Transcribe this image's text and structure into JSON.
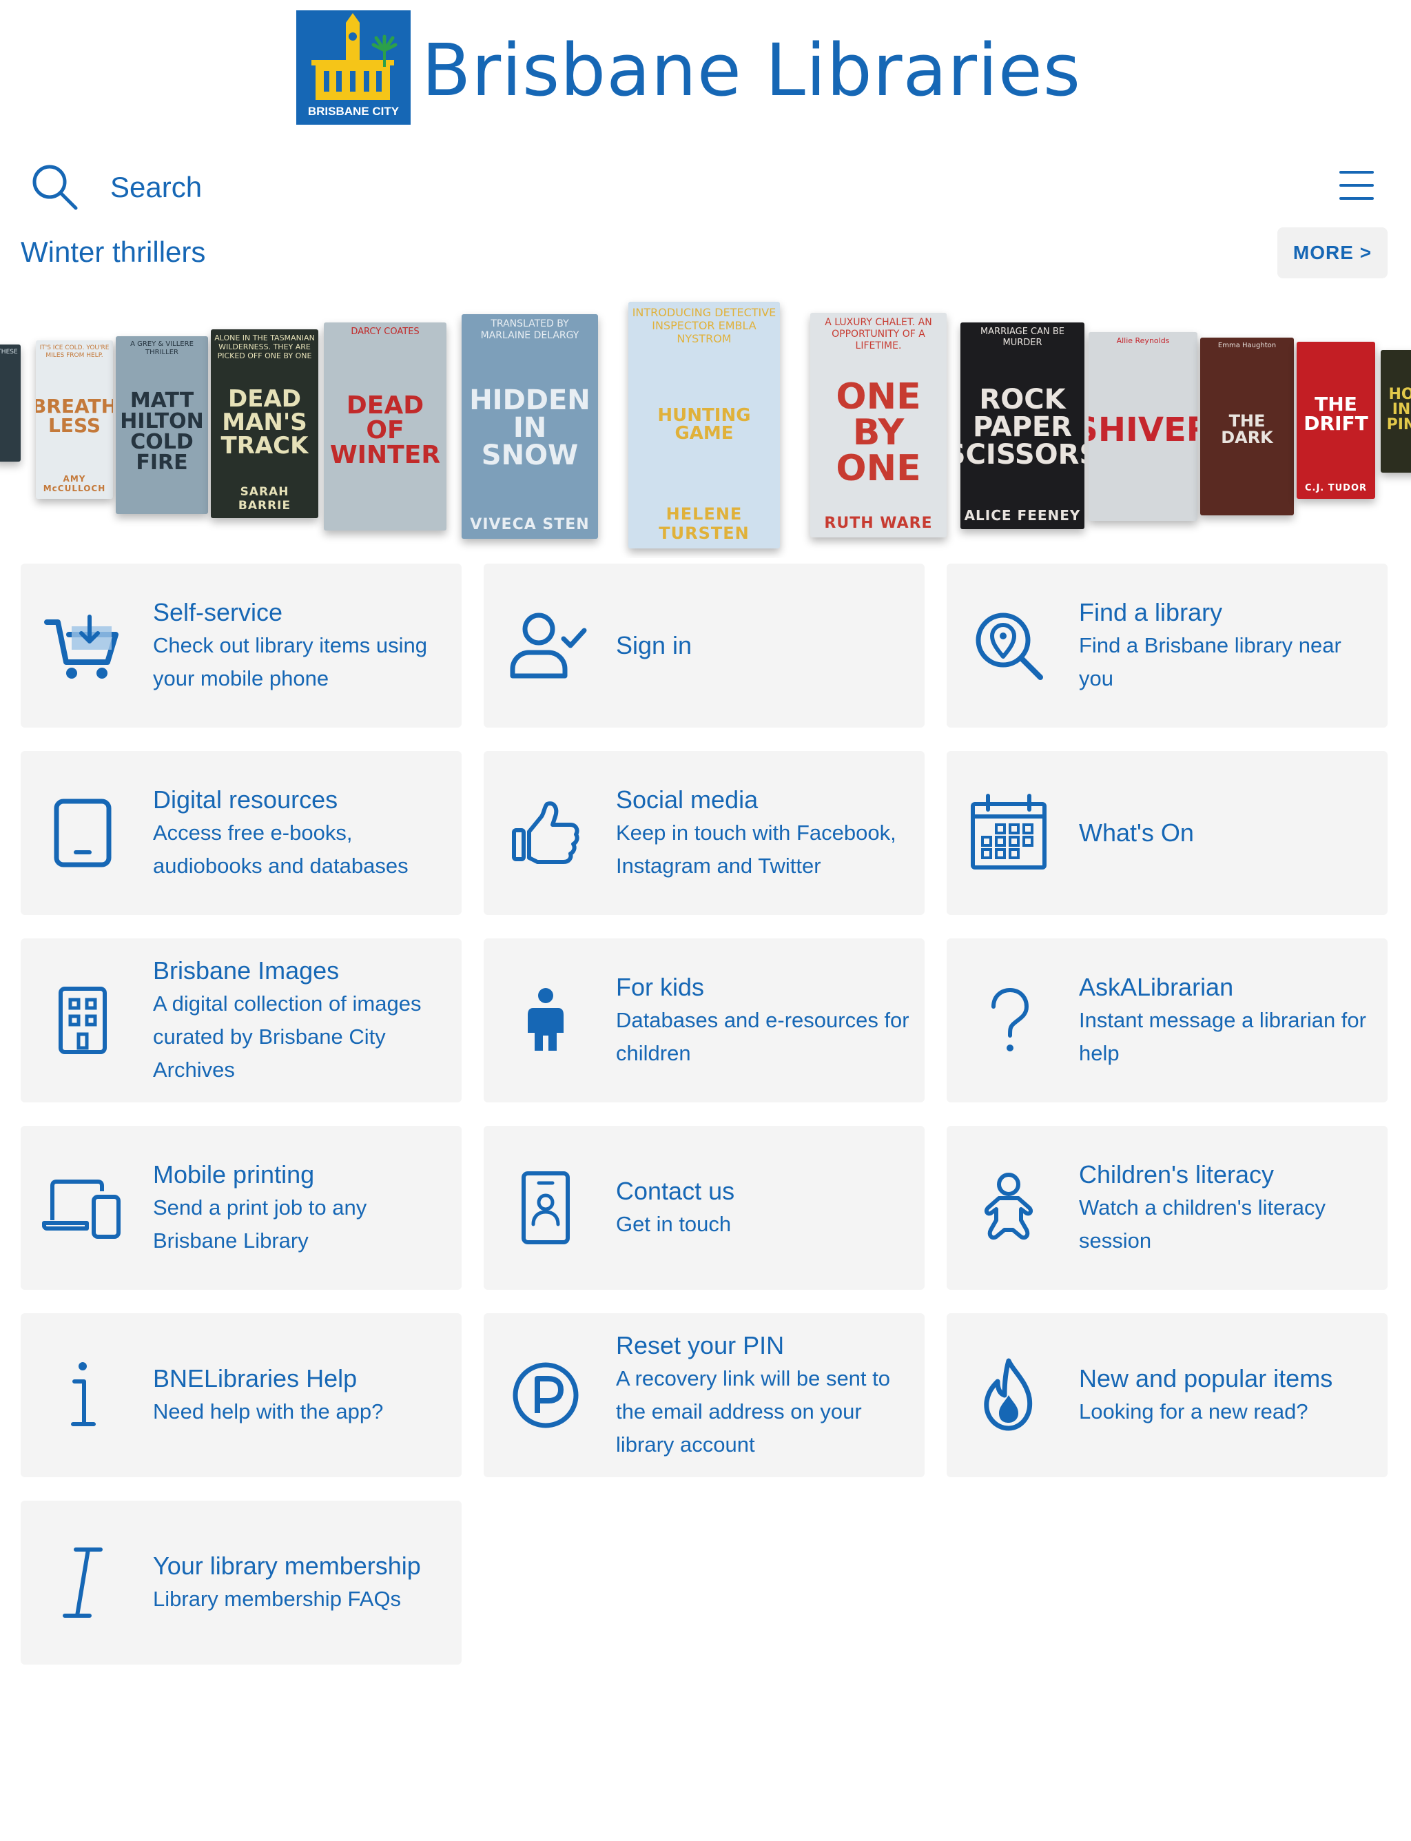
{
  "header": {
    "logo_text": "BRISBANE CITY",
    "title": "Brisbane Libraries"
  },
  "search": {
    "label": "Search"
  },
  "menu_icon": "hamburger-menu-icon",
  "shelf": {
    "title": "Winter thrillers",
    "more_label": "MORE >",
    "books": [
      {
        "title": "",
        "subtitle": "THESE",
        "author": "",
        "bg": "#2d3c44",
        "fg": "#d9e4ea"
      },
      {
        "title": "BREATH LESS",
        "subtitle": "IT'S ICE COLD. YOU'RE MILES FROM HELP.",
        "author": "AMY McCULLOCH",
        "bg": "#e6ebee",
        "fg": "#c4793a"
      },
      {
        "title": "MATT HILTON COLD FIRE",
        "subtitle": "A GREY & VILLERE THRILLER",
        "author": "",
        "bg": "#8fa5b3",
        "fg": "#263540"
      },
      {
        "title": "DEAD MAN'S TRACK",
        "subtitle": "ALONE IN THE TASMANIAN WILDERNESS. THEY ARE PICKED OFF ONE BY ONE",
        "author": "SARAH BARRIE",
        "bg": "#28302a",
        "fg": "#e6e1b8"
      },
      {
        "title": "DEAD OF WINTER",
        "subtitle": "DARCY COATES",
        "author": "",
        "bg": "#b6c2c9",
        "fg": "#c12a2a"
      },
      {
        "title": "HIDDEN IN SNOW",
        "subtitle": "TRANSLATED BY MARLAINE DELARGY",
        "author": "VIVECA STEN",
        "bg": "#7d9fba",
        "fg": "#e8eef3"
      },
      {
        "title": "HUNTING GAME",
        "subtitle": "INTRODUCING DETECTIVE INSPECTOR EMBLA NYSTROM",
        "author": "HELENE TURSTEN",
        "bg": "#cfe0ee",
        "fg": "#e0b13a"
      },
      {
        "title": "ONE BY ONE",
        "subtitle": "A LUXURY CHALET. AN OPPORTUNITY OF A LIFETIME.",
        "author": "RUTH WARE",
        "bg": "#dfe3e6",
        "fg": "#c73b31"
      },
      {
        "title": "ROCK PAPER SCISSORS",
        "subtitle": "MARRIAGE CAN BE MURDER",
        "author": "ALICE FEENEY",
        "bg": "#1c1c1f",
        "fg": "#e9e4df"
      },
      {
        "title": "SHIVER",
        "subtitle": "Allie Reynolds",
        "author": "",
        "bg": "#d4d8db",
        "fg": "#c5262d"
      },
      {
        "title": "THE DARK",
        "subtitle": "Emma Haughton",
        "author": "",
        "bg": "#5a2a22",
        "fg": "#e9e4df"
      },
      {
        "title": "THE DRIFT",
        "subtitle": "",
        "author": "C.J. TUDOR",
        "bg": "#c31e24",
        "fg": "#ffffff"
      },
      {
        "title": "HO IN PIN",
        "subtitle": "",
        "author": "",
        "bg": "#2c2e1f",
        "fg": "#e3c94a"
      }
    ]
  },
  "tiles": [
    {
      "icon": "shopping-cart-download-icon",
      "title": "Self-service",
      "desc": "Check out library items using your mobile phone"
    },
    {
      "icon": "user-check-icon",
      "title": "Sign in",
      "desc": ""
    },
    {
      "icon": "search-location-icon",
      "title": "Find a library",
      "desc": "Find a Brisbane library near you"
    },
    {
      "icon": "tablet-icon",
      "title": "Digital resources",
      "desc": "Access free e-books, audiobooks and databases"
    },
    {
      "icon": "thumbs-up-icon",
      "title": "Social media",
      "desc": "Keep in touch with Facebook, Instagram and Twitter"
    },
    {
      "icon": "calendar-icon",
      "title": "What's On",
      "desc": ""
    },
    {
      "icon": "building-icon",
      "title": "Brisbane Images",
      "desc": "A digital collection of images curated by Brisbane City Archives"
    },
    {
      "icon": "child-icon",
      "title": "For kids",
      "desc": "Databases and e-resources for children"
    },
    {
      "icon": "question-mark-icon",
      "title": "AskALibrarian",
      "desc": "Instant message a librarian for help"
    },
    {
      "icon": "laptop-mobile-icon",
      "title": "Mobile printing",
      "desc": "Send a print job to any Brisbane Library"
    },
    {
      "icon": "contact-badge-icon",
      "title": "Contact us",
      "desc": "Get in touch"
    },
    {
      "icon": "baby-icon",
      "title": "Children's literacy",
      "desc": "Watch a children's literacy session"
    },
    {
      "icon": "info-icon",
      "title": "BNELibraries Help",
      "desc": "Need help with the app?"
    },
    {
      "icon": "pin-reset-icon",
      "title": "Reset your PIN",
      "desc": "A recovery link will be sent to the email address on your library account"
    },
    {
      "icon": "fire-icon",
      "title": "New and popular items",
      "desc": "Looking for a new read?"
    },
    {
      "icon": "italic-i-icon",
      "title": "Your library membership",
      "desc": "Library membership FAQs"
    }
  ],
  "colors": {
    "brand_blue": "#1667b5",
    "tile_bg": "#f4f4f4",
    "logo_yellow": "#f5c518",
    "logo_green": "#2ca04a"
  }
}
